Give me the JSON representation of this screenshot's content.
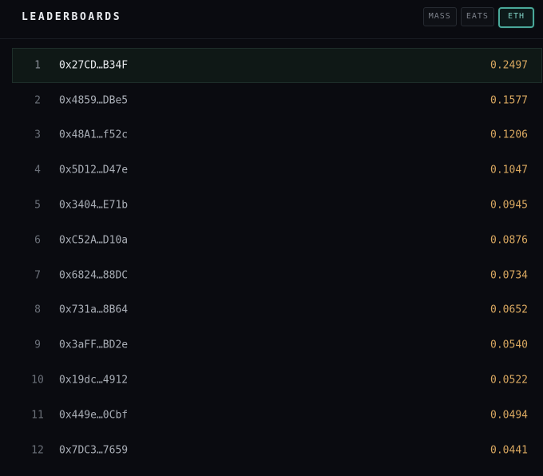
{
  "header": {
    "title": "LEADERBOARDS",
    "tabs": [
      {
        "label": "MASS",
        "active": false
      },
      {
        "label": "EATS",
        "active": false
      },
      {
        "label": "ETH",
        "active": true
      }
    ]
  },
  "colors": {
    "background": "#0a0b10",
    "accent": "#4aa89a",
    "value": "#d9a860"
  },
  "leaderboard": [
    {
      "rank": "1",
      "address": "0x27CD…B34F",
      "value": "0.2497"
    },
    {
      "rank": "2",
      "address": "0x4859…DBe5",
      "value": "0.1577"
    },
    {
      "rank": "3",
      "address": "0x48A1…f52c",
      "value": "0.1206"
    },
    {
      "rank": "4",
      "address": "0x5D12…D47e",
      "value": "0.1047"
    },
    {
      "rank": "5",
      "address": "0x3404…E71b",
      "value": "0.0945"
    },
    {
      "rank": "6",
      "address": "0xC52A…D10a",
      "value": "0.0876"
    },
    {
      "rank": "7",
      "address": "0x6824…88DC",
      "value": "0.0734"
    },
    {
      "rank": "8",
      "address": "0x731a…8B64",
      "value": "0.0652"
    },
    {
      "rank": "9",
      "address": "0x3aFF…BD2e",
      "value": "0.0540"
    },
    {
      "rank": "10",
      "address": "0x19dc…4912",
      "value": "0.0522"
    },
    {
      "rank": "11",
      "address": "0x449e…0Cbf",
      "value": "0.0494"
    },
    {
      "rank": "12",
      "address": "0x7DC3…7659",
      "value": "0.0441"
    }
  ]
}
